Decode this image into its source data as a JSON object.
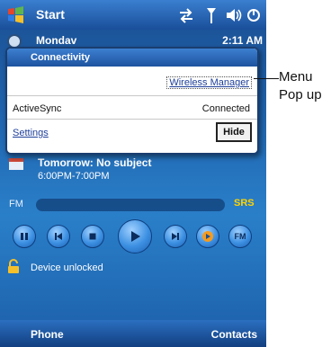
{
  "titlebar": {
    "title": "Start"
  },
  "today": {
    "date": "Mondav",
    "time": "2:11 AM",
    "appointment_title": "Tomorrow: No subject",
    "appointment_time": "6:00PM-7:00PM"
  },
  "popup": {
    "title": "Connectivity",
    "wireless_manager_link": "Wireless Manager",
    "activesync_label": "ActiveSync",
    "activesync_status": "Connected",
    "settings_link": "Settings",
    "hide_button": "Hide"
  },
  "media": {
    "fm_label": "FM",
    "srs_label": "SRS",
    "buttons": [
      "pause",
      "previous",
      "stop",
      "play",
      "next",
      "media-player",
      "FM"
    ],
    "fm_button_label": "FM"
  },
  "lock": {
    "text": "Device unlocked"
  },
  "softkeys": {
    "left": "Phone",
    "right": "Contacts"
  },
  "annotation": {
    "text": "Menu\nPop up"
  },
  "colors": {
    "accent": "#1f63ad",
    "srs": "#ffd400",
    "link": "#1f3f9a"
  }
}
